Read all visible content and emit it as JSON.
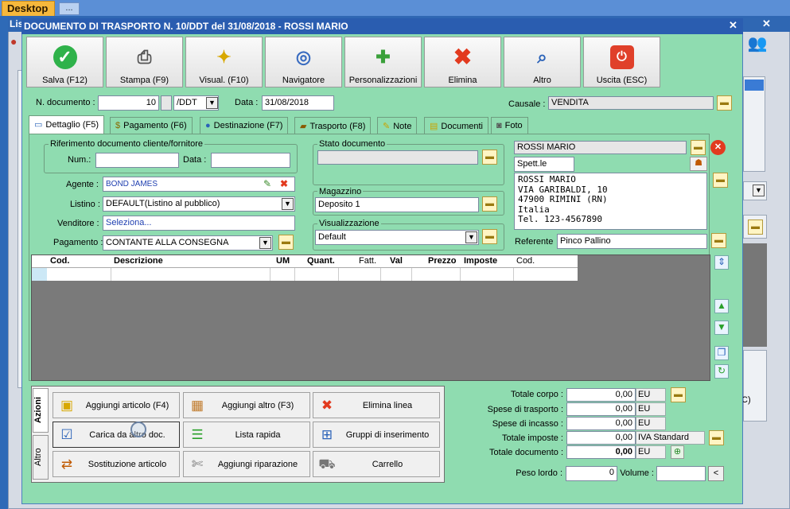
{
  "desktop_tabs": {
    "desktop": "Desktop",
    "more": "..."
  },
  "bg_window": {
    "title": "Lis"
  },
  "bg_side": {
    "label": "C)"
  },
  "dialog": {
    "title": "DOCUMENTO DI TRASPORTO N. 10/DDT del 31/08/2018 - ROSSI MARIO"
  },
  "toolbar": [
    {
      "label": "Salva (F12)",
      "icon": "check-icon"
    },
    {
      "label": "Stampa (F9)",
      "icon": "printer-icon"
    },
    {
      "label": "Visual. (F10)",
      "icon": "magic-wand-icon"
    },
    {
      "label": "Navigatore",
      "icon": "navigator-icon"
    },
    {
      "label": "Personalizzazioni",
      "icon": "puzzle-icon"
    },
    {
      "label": "Elimina",
      "icon": "delete-x-icon"
    },
    {
      "label": "Altro",
      "icon": "magnifier-icon"
    },
    {
      "label": "Uscita (ESC)",
      "icon": "exit-icon"
    }
  ],
  "header": {
    "n_doc_label": "N. documento :",
    "n_doc_value": "10",
    "series": "/DDT",
    "data_label": "Data :",
    "data_value": "31/08/2018",
    "causale_label": "Causale :",
    "causale_value": "VENDITA"
  },
  "tabs": [
    "Dettaglio (F5)",
    "Pagamento (F6)",
    "Destinazione (F7)",
    "Trasporto (F8)",
    "Note",
    "Documenti",
    "Foto"
  ],
  "rif": {
    "title": "Riferimento documento cliente/fornitore",
    "num_label": "Num.:",
    "data_label": "Data :"
  },
  "agente": {
    "label": "Agente :",
    "value": "BOND JAMES"
  },
  "listino": {
    "label": "Listino :",
    "value": "DEFAULT(Listino al pubblico)"
  },
  "venditore": {
    "label": "Venditore :",
    "value": "Seleziona..."
  },
  "pagamento": {
    "label": "Pagamento :",
    "value": "CONTANTE ALLA CONSEGNA"
  },
  "stato": {
    "title": "Stato documento"
  },
  "magazzino": {
    "title": "Magazzino",
    "value": "Deposito 1"
  },
  "visualizzazione": {
    "title": "Visualizzazione",
    "value": "Default"
  },
  "cliente": {
    "name": "ROSSI MARIO",
    "salutation": "Spett.le",
    "address": [
      "ROSSI MARIO",
      "VIA GARIBALDI, 10",
      "47900 RIMINI (RN)",
      "Italia",
      "Tel. 123-4567890"
    ],
    "referente_label": "Referente",
    "referente_value": "Pinco Pallino"
  },
  "grid": {
    "columns": [
      "Cod.",
      "Descrizione",
      "UM",
      "Quant.",
      "Fatt.",
      "Val",
      "Prezzo",
      "Imposte",
      "Cod."
    ]
  },
  "side_tabs": {
    "azioni": "Azioni",
    "altro": "Altro"
  },
  "actions": [
    {
      "label": "Aggiungi articolo (F4)",
      "icon": "add-article-icon"
    },
    {
      "label": "Aggiungi altro (F3)",
      "icon": "add-other-icon"
    },
    {
      "label": "Elimina linea",
      "icon": "delete-line-icon"
    },
    {
      "label": "Carica da altro doc.",
      "icon": "load-doc-icon"
    },
    {
      "label": "Lista rapida",
      "icon": "quick-list-icon"
    },
    {
      "label": "Gruppi di inserimento",
      "icon": "insert-groups-icon"
    },
    {
      "label": "Sostituzione articolo",
      "icon": "replace-article-icon"
    },
    {
      "label": "Aggiungi riparazione",
      "icon": "repair-icon"
    },
    {
      "label": "Carrello",
      "icon": "cart-icon"
    }
  ],
  "totals": {
    "corpo_label": "Totale corpo :",
    "corpo_value": "0,00",
    "corpo_unit": "EU",
    "trasporto_label": "Spese di trasporto :",
    "trasporto_value": "0,00",
    "trasporto_unit": "EU",
    "incasso_label": "Spese di incasso :",
    "incasso_value": "0,00",
    "incasso_unit": "EU",
    "imposte_label": "Totale imposte :",
    "imposte_value": "0,00",
    "imposte_unit": "IVA Standard",
    "documento_label": "Totale documento :",
    "documento_value": "0,00",
    "documento_unit": "EU",
    "peso_label": "Peso lordo :",
    "peso_value": "0",
    "volume_label": "Volume :",
    "volume_btn": "<"
  }
}
